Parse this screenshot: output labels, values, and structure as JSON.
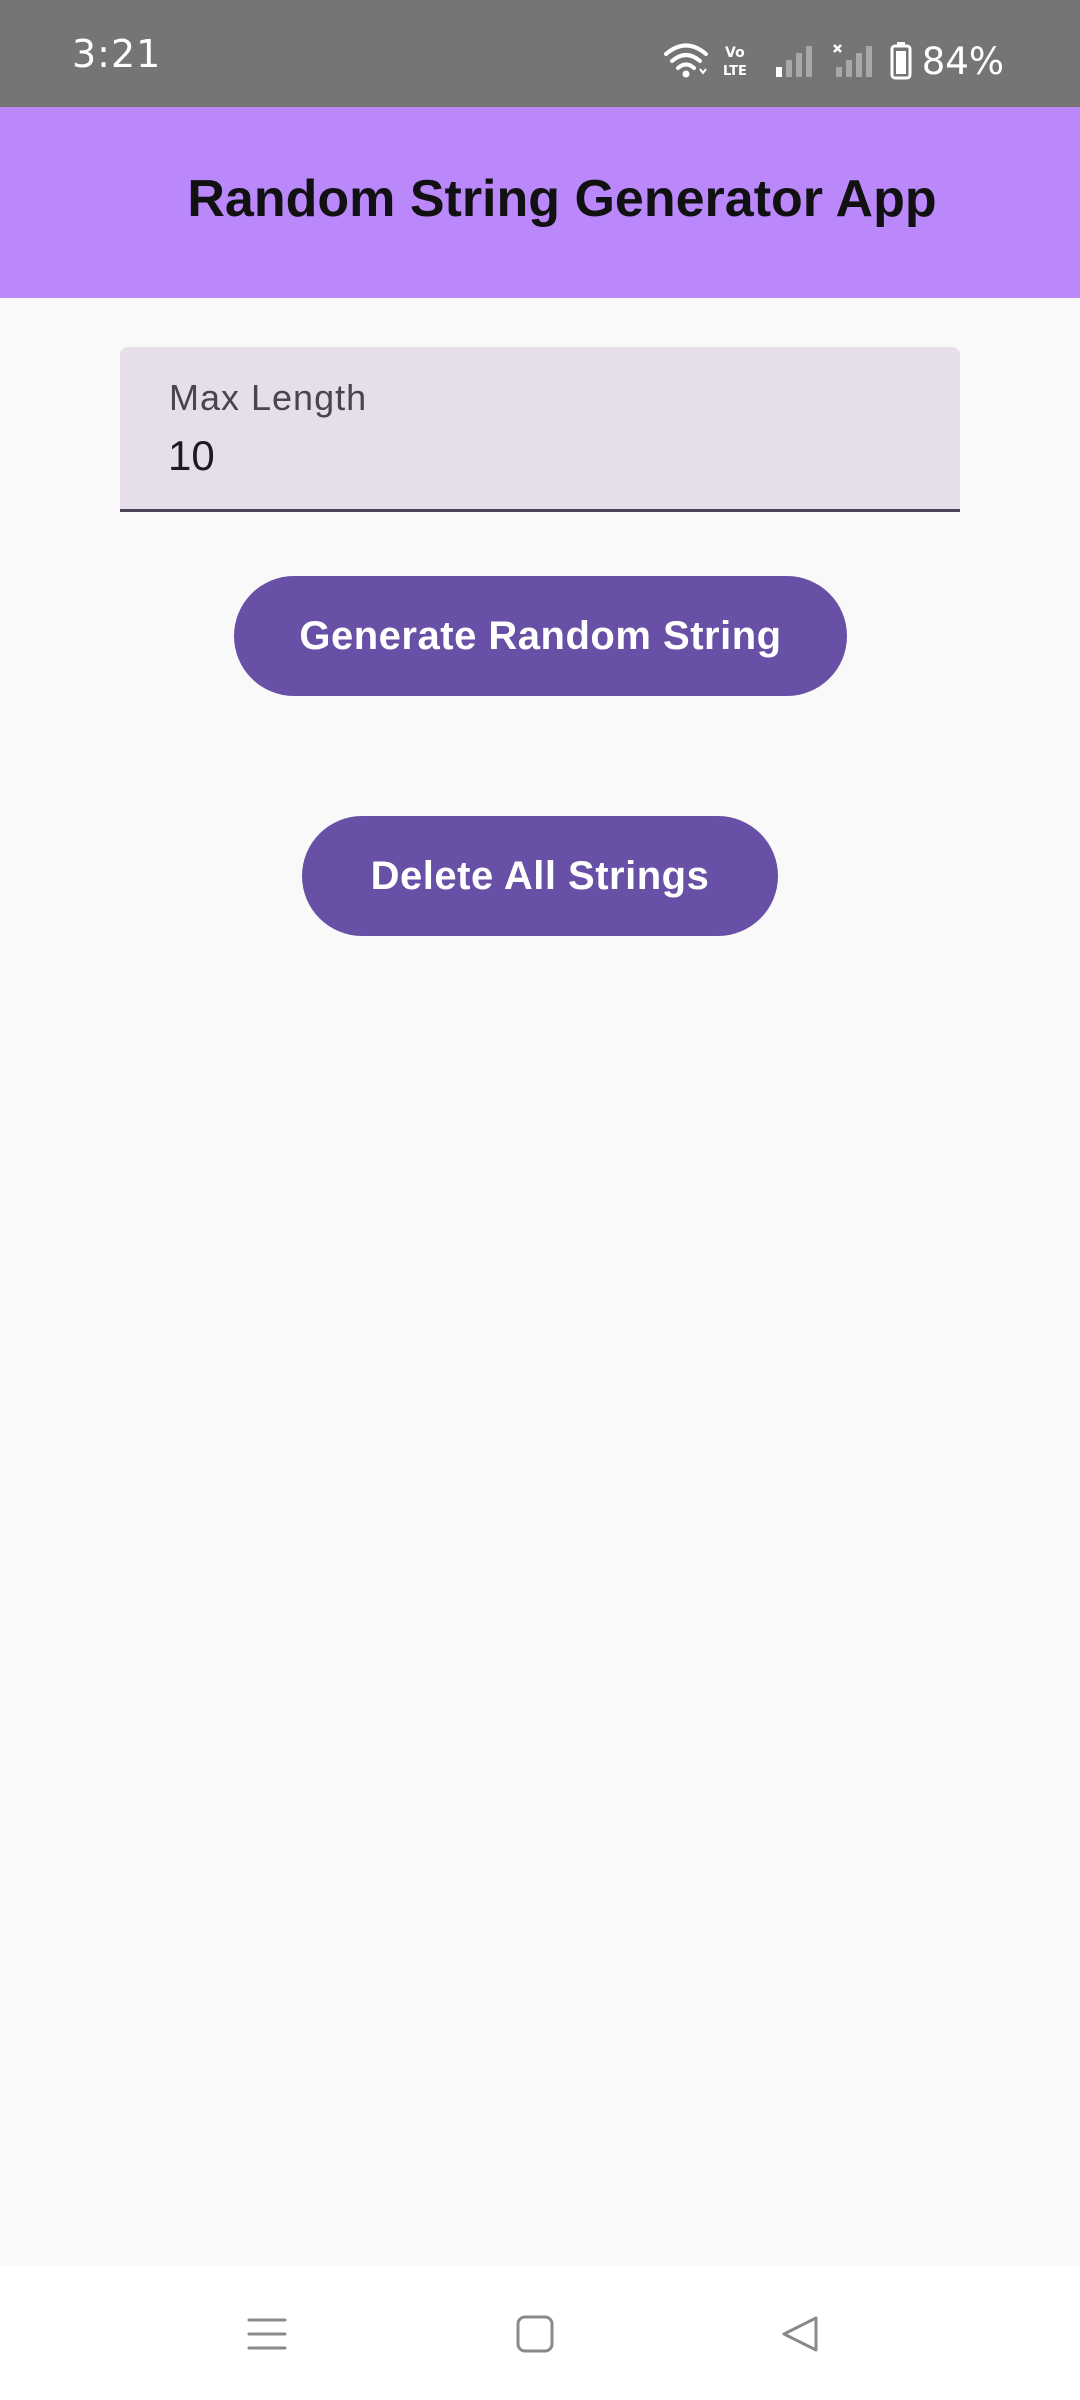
{
  "status_bar": {
    "time": "3:21",
    "battery_percent": "84%",
    "icons": [
      "wifi-icon",
      "volte-icon",
      "signal-icon",
      "signal-no-service-icon",
      "battery-icon"
    ]
  },
  "app_bar": {
    "title": "Random String Generator App",
    "color": "#bb88fc"
  },
  "max_length_field": {
    "label": "Max Length",
    "value": "10"
  },
  "buttons": {
    "generate_label": "Generate Random String",
    "delete_label": "Delete All Strings",
    "color": "#6750a5"
  },
  "nav_bar": {
    "icons": [
      "recent-apps-icon",
      "home-icon",
      "back-icon"
    ]
  }
}
